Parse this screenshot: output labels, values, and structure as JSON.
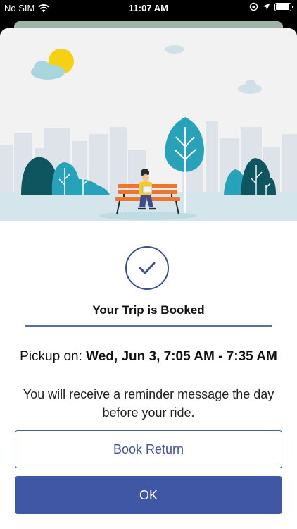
{
  "status_bar": {
    "carrier": "No SIM",
    "time": "11:07 AM"
  },
  "confirmation": {
    "title": "Your Trip is Booked",
    "pickup_label": "Pickup on:",
    "pickup_time": "Wed, Jun 3, 7:05 AM - 7:35 AM",
    "reminder": "You will receive a reminder message the day before your ride."
  },
  "buttons": {
    "book_return": "Book Return",
    "ok": "OK"
  },
  "colors": {
    "accent": "#4057a6",
    "teal": "#26a3b8",
    "dark_teal": "#0f5560",
    "bench": "#f0742a"
  }
}
